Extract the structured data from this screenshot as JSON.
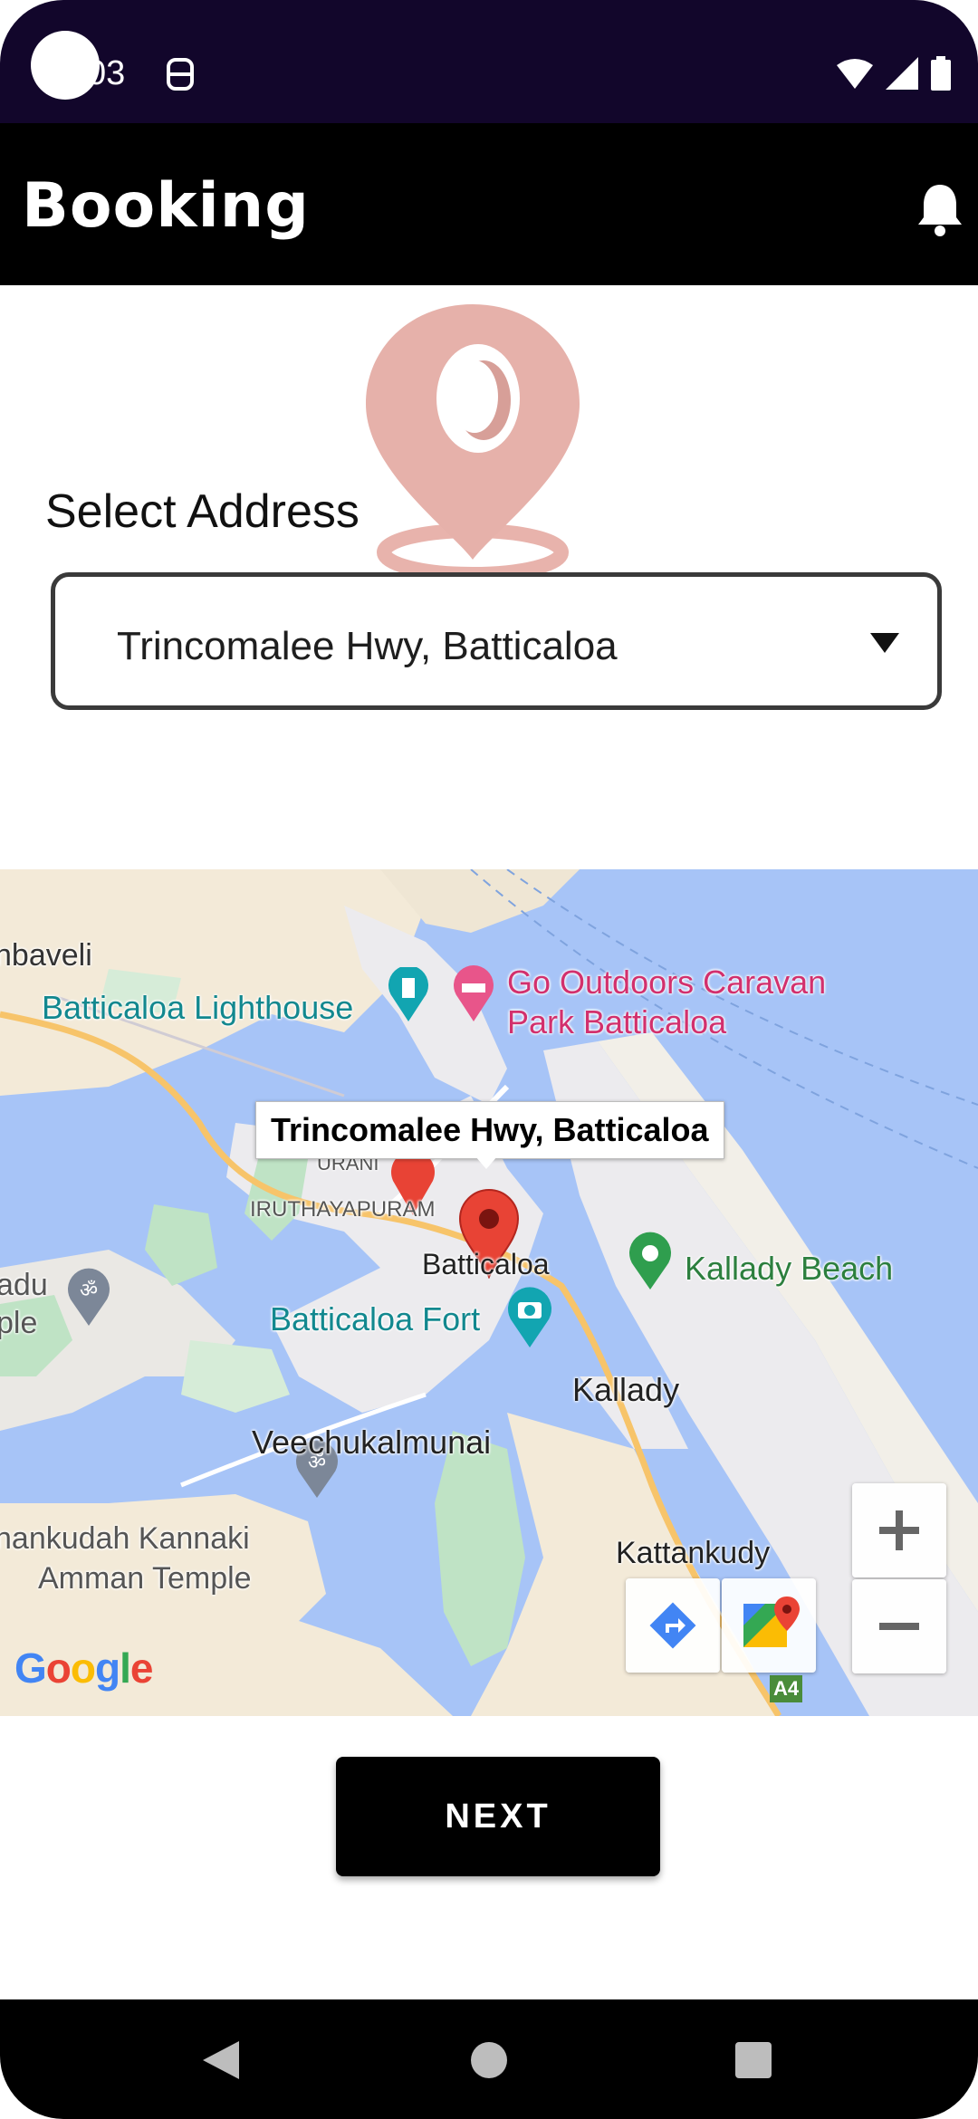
{
  "status_bar": {
    "time": "03"
  },
  "app_bar": {
    "title": "Booking"
  },
  "form": {
    "label": "Select Address",
    "selected_address": "Trincomalee Hwy, Batticaloa"
  },
  "map": {
    "info_window": "Trincomalee Hwy, Batticaloa",
    "places": {
      "mahiladithivu": "nbaveli",
      "lighthouse": "Batticaloa Lighthouse",
      "go_outdoors_1": "Go Outdoors Caravan",
      "go_outdoors_2": "Park Batticaloa",
      "urani": "URANI",
      "iruthayapuram": "IRUTHAYAPURAM",
      "batticaloa": "Batticaloa",
      "kallady_beach": "Kallady Beach",
      "batticaloa_fort": "Batticaloa Fort",
      "temple_left_1": "adu",
      "temple_left_2": "ple",
      "kallady": "Kallady",
      "veechukalmunai": "Veechukalmunai",
      "kannaki_1": "nankudah Kannaki",
      "kannaki_2": "Amman Temple",
      "kattankudy": "Kattankudy",
      "road_shield": "A4"
    },
    "google_logo": "Google",
    "zoom_in": "+",
    "zoom_out": "−"
  },
  "actions": {
    "next_label": "NEXT"
  },
  "colors": {
    "app_bar": "#000000",
    "status_bar": "#12062b",
    "water": "#a7c4f7",
    "marker": "#e84335"
  }
}
